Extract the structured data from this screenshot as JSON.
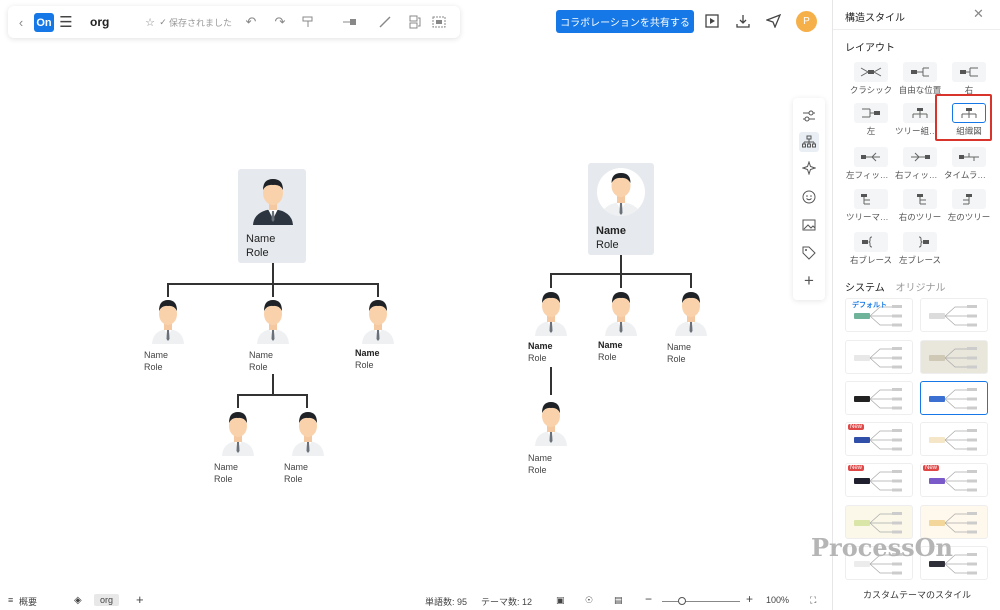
{
  "toolbar": {
    "back_icon": "chevron-left-icon",
    "logo_text": "On",
    "menu_icon": "hamburger-icon",
    "doc_name": "org",
    "saved_status": "保存されました",
    "share_label": "コラボレーションを共有する",
    "avatar_letter": "P",
    "accent_color": "#1678e6"
  },
  "canvas": {
    "tree1": {
      "root": {
        "name": "Name",
        "role": "Role"
      },
      "children": [
        {
          "name": "Name",
          "role": "Role",
          "bold": false
        },
        {
          "name": "Name",
          "role": "Role",
          "bold": false
        },
        {
          "name": "Name",
          "role": "Role",
          "bold": true
        }
      ],
      "grandchildren": [
        {
          "name": "Name",
          "role": "Role"
        },
        {
          "name": "Name",
          "role": "Role"
        }
      ]
    },
    "tree2": {
      "root": {
        "name": "Name",
        "role": "Role"
      },
      "children": [
        {
          "name": "Name",
          "role": "Role",
          "bold": true
        },
        {
          "name": "Name",
          "role": "Role",
          "bold": true
        },
        {
          "name": "Name",
          "role": "Role",
          "bold": false
        }
      ],
      "grandchild": {
        "name": "Name",
        "role": "Role"
      }
    }
  },
  "panel": {
    "title": "構造スタイル",
    "layout_heading": "レイアウト",
    "layouts": [
      "クラシック",
      "自由な位置",
      "右",
      "左",
      "ツリー組織図",
      "組織図",
      "左フィッシュボーン",
      "右フィッシュボーン",
      "タイムライン",
      "ツリーマップ",
      "右のツリー",
      "左のツリー",
      "右ブレース",
      "左ブレース"
    ],
    "selected_layout": "組織図",
    "tab_system": "システム",
    "tab_original": "オリジナル",
    "theme_default_label": "デフォルト",
    "new_badge": "New",
    "custom_theme": "カスタムテーマのスタイル",
    "selection_color": "#d9342b"
  },
  "watermark": "ProcessOn",
  "statusbar": {
    "outline": "概要",
    "sheet_tab": "org",
    "word_count": "単語数: 95",
    "theme_count": "テーマ数: 12",
    "zoom": "100%",
    "zoom_fraction": 0.25
  }
}
